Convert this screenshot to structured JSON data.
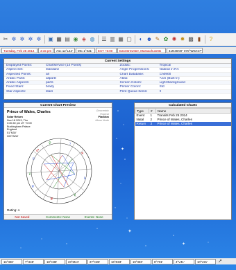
{
  "toolbar": {
    "icons": [
      "scissors-icon",
      "gear-icon",
      "gear-icon",
      "gear-icon",
      "gear-icon",
      "folder-icon",
      "window-icon",
      "grid-icon",
      "chart-icon",
      "palette-icon",
      "globe-icon",
      "list-icon",
      "calendar-icon",
      "table-icon",
      "document-icon",
      "chart-icon",
      "user-icon",
      "pencil-icon",
      "settings-icon",
      "wheel-icon",
      "star-icon",
      "grid-icon",
      "book-icon",
      "help-icon"
    ]
  },
  "infobar": {
    "date": "Tuesday, Feb 25 2014",
    "time": "3:15 pm",
    "asc": "Asc 12°L44'",
    "mc": "MC 1°II31'",
    "zone": "EST +5:00",
    "location": "East Brewster, Massachusetts",
    "coords": "41N46'00\" 070°W03'27\""
  },
  "settings": {
    "title": "Current Settings",
    "left": [
      {
        "label": "Displayed Points:",
        "value": "Chartservice (14 Points)"
      },
      {
        "label": "Aspect Set:",
        "value": "standard"
      },
      {
        "label": "Aspected Points:",
        "value": "all"
      },
      {
        "label": "Arabic Parts:",
        "value": "allparts"
      },
      {
        "label": "Arabic Aspects:",
        "value": "parts"
      },
      {
        "label": "Fixed Stars:",
        "value": "brady"
      },
      {
        "label": "Star Aspects:",
        "value": "stars"
      }
    ],
    "right": [
      {
        "label": "Zodiac:",
        "value": "Tropical"
      },
      {
        "label": "Angle Progressions:",
        "value": "Naibod in RA"
      },
      {
        "label": "Chart Database:",
        "value": "Ch0900"
      },
      {
        "label": "Atlas:",
        "value": "ACS (Built-in)"
      },
      {
        "label": "Screen Colors:",
        "value": "Light Background"
      },
      {
        "label": "Printer Colors:",
        "value": "Std"
      },
      {
        "label": "Print Queue Items:",
        "value": "0"
      }
    ]
  },
  "preview": {
    "title": "Current Chart Preview",
    "name": "Prince of Wales, Charles",
    "lines": [
      "Solar Return",
      "Nov 18 2013, Thu",
      "3:30:40 pm  UT +0:00",
      "Buckingham Palace",
      "England",
      "51°N30'",
      "000°W08'"
    ],
    "right_lines": [
      "Geocentric",
      "Tropical",
      "Placidus",
      "Mean Node"
    ],
    "rating": "Rating: A",
    "status": [
      {
        "label": "Not Saved",
        "color": "red"
      },
      {
        "label": "Comments: None",
        "color": "green"
      },
      {
        "label": "Events: None",
        "color": "green"
      }
    ]
  },
  "calc": {
    "title": "Calculated Charts",
    "columns": [
      "Type",
      "#",
      "Name"
    ],
    "rows": [
      {
        "type": "Event",
        "num": "1",
        "name": "Transits Feb 25 2014"
      },
      {
        "type": "Natal",
        "num": "2",
        "name": "Prince of Wales, Charles"
      },
      {
        "type": "Return",
        "num": "3",
        "name": "Prince of Wales, Charles"
      }
    ],
    "selected_row": 2
  },
  "bottombar": {
    "cells": [
      "16°II26'",
      "7°H45'",
      "18°H35'",
      "23°M44'",
      "27°H26'",
      "16°D33'",
      "19°II33'",
      "8°Y01'",
      "4°V41'",
      "10°V21'"
    ]
  },
  "colors": {
    "accent": "#3a6fd8",
    "label_blue": "#1a37a8",
    "status_red": "#c00000",
    "status_green": "#1a7a1a"
  }
}
